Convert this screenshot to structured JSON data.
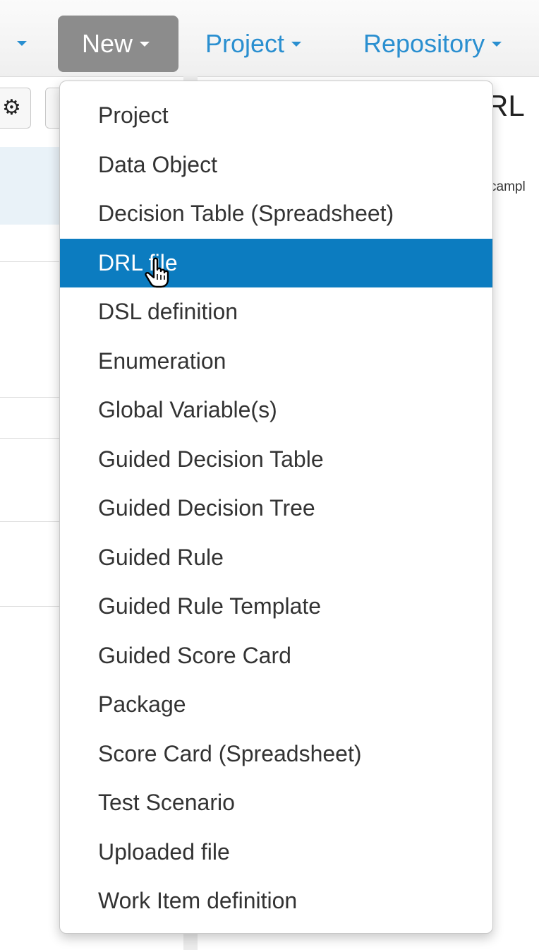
{
  "navbar": {
    "new_label": "New",
    "project_label": "Project",
    "repository_label": "Repository"
  },
  "toolbar": {
    "gear_icon": "gear-icon"
  },
  "editor": {
    "heading_fragment": "RL",
    "text_fragment": "campl"
  },
  "new_menu": {
    "active_index": 3,
    "items": [
      "Project",
      "Data Object",
      "Decision Table (Spreadsheet)",
      "DRL file",
      "DSL definition",
      "Enumeration",
      "Global Variable(s)",
      "Guided Decision Table",
      "Guided Decision Tree",
      "Guided Rule",
      "Guided Rule Template",
      "Guided Score Card",
      "Package",
      "Score Card (Spreadsheet)",
      "Test Scenario",
      "Uploaded file",
      "Work Item definition"
    ]
  },
  "colors": {
    "accent": "#2a8fd0",
    "active_bg": "#0c7cc0",
    "new_button_bg": "#8c8c8c"
  }
}
